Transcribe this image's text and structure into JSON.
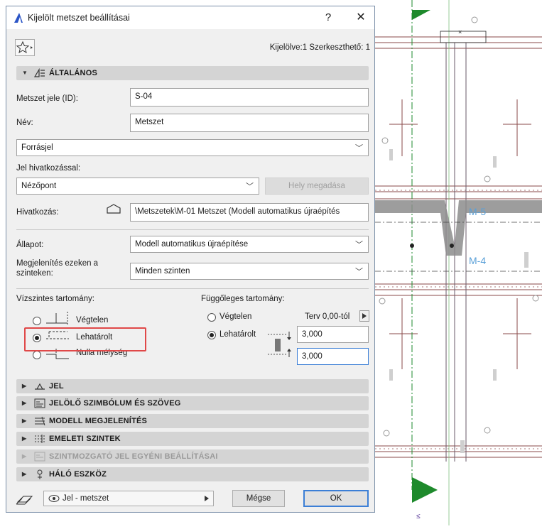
{
  "dialog": {
    "title": "Kijelölt metszet beállításai",
    "help_label": "?",
    "close_label": "✕",
    "selection_info": "Kijelölve:1 Szerkeszthető: 1"
  },
  "general": {
    "header": "ÁLTALÁNOS",
    "id_label": "Metszet jele (ID):",
    "id_value": "S-04",
    "name_label": "Név:",
    "name_value": "Metszet",
    "source_value": "Forrásjel",
    "ref_with_label": "Jel hivatkozással:",
    "ref_with_value": "Nézőpont",
    "location_button": "Hely megadása",
    "reference_label": "Hivatkozás:",
    "reference_value": "\\Metszetek\\M-01 Metszet (Modell automatikus újraépítés",
    "status_label": "Állapot:",
    "status_value": "Modell automatikus újraépítése",
    "display_levels_label_1": "Megjelenítés ezeken a",
    "display_levels_label_2": "szinteken:",
    "display_levels_value": "Minden szinten"
  },
  "horizontal": {
    "title": "Vízszintes tartomány:",
    "options": [
      "Végtelen",
      "Lehatárolt",
      "Nulla mélység"
    ],
    "selected": "Lehatárolt"
  },
  "vertical": {
    "title": "Függőleges tartomány:",
    "opt_infinite": "Végtelen",
    "opt_limited": "Lehatárolt",
    "ref_label": "Terv 0,00-tól",
    "top_value": "3,000",
    "bottom_value": "3,000"
  },
  "sections": [
    {
      "label": "JEL",
      "disabled": false
    },
    {
      "label": "JELÖLŐ SZIMBÓLUM ÉS SZÖVEG",
      "disabled": false
    },
    {
      "label": "MODELL MEGJELENÍTÉS",
      "disabled": false
    },
    {
      "label": "EMELETI SZINTEK",
      "disabled": false
    },
    {
      "label": "SZINTMOZGATÓ JEL EGYÉNI BEÁLLÍTÁSAI",
      "disabled": true
    },
    {
      "label": "HÁLÓ ESZKÖZ",
      "disabled": false
    }
  ],
  "footer": {
    "layer_value": "Jel - metszet",
    "cancel_label": "Mégse",
    "ok_label": "OK"
  },
  "drawing": {
    "labels": [
      "M-5",
      "M-4"
    ],
    "accent_green": "#1e8a2c",
    "label_blue": "#5aa0d8"
  }
}
